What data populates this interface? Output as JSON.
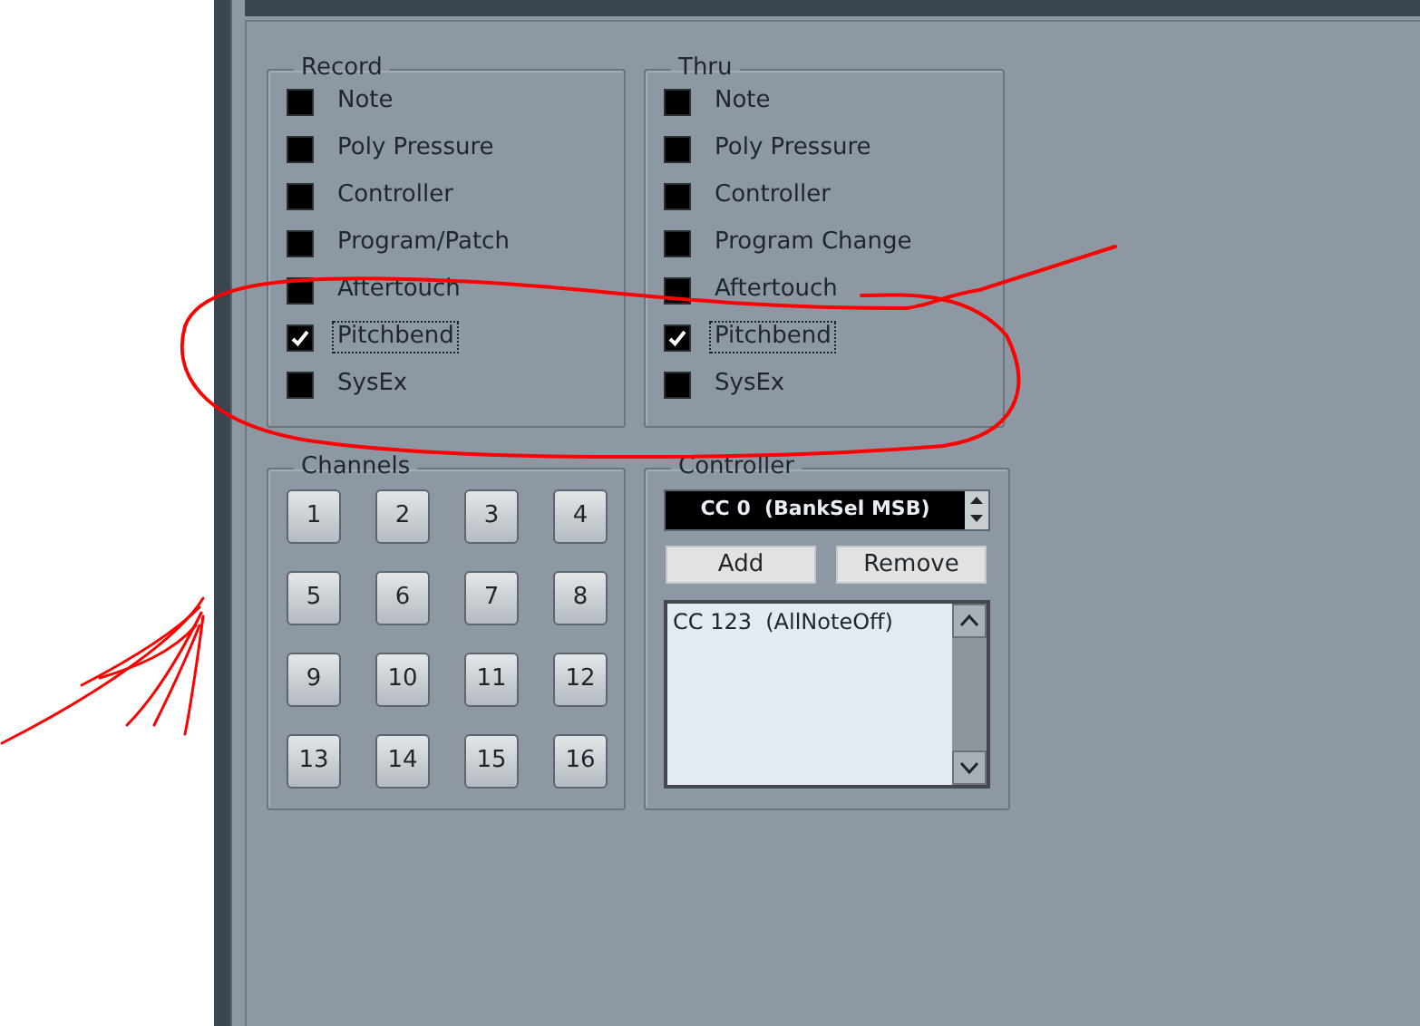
{
  "record": {
    "title": "Record",
    "items": [
      {
        "label": "Note",
        "checked": false,
        "focused": false
      },
      {
        "label": "Poly Pressure",
        "checked": false,
        "focused": false
      },
      {
        "label": "Controller",
        "checked": false,
        "focused": false
      },
      {
        "label": "Program/Patch",
        "checked": false,
        "focused": false
      },
      {
        "label": "Aftertouch",
        "checked": false,
        "focused": false
      },
      {
        "label": "Pitchbend",
        "checked": true,
        "focused": true
      },
      {
        "label": "SysEx",
        "checked": false,
        "focused": false
      }
    ]
  },
  "thru": {
    "title": "Thru",
    "items": [
      {
        "label": "Note",
        "checked": false,
        "focused": false
      },
      {
        "label": "Poly Pressure",
        "checked": false,
        "focused": false
      },
      {
        "label": "Controller",
        "checked": false,
        "focused": false
      },
      {
        "label": "Program Change",
        "checked": false,
        "focused": false
      },
      {
        "label": "Aftertouch",
        "checked": false,
        "focused": false
      },
      {
        "label": "Pitchbend",
        "checked": true,
        "focused": true
      },
      {
        "label": "SysEx",
        "checked": false,
        "focused": false
      }
    ]
  },
  "channels": {
    "title": "Channels",
    "buttons": [
      "1",
      "2",
      "3",
      "4",
      "5",
      "6",
      "7",
      "8",
      "9",
      "10",
      "11",
      "12",
      "13",
      "14",
      "15",
      "16"
    ]
  },
  "controller": {
    "title": "Controller",
    "selector": {
      "value": "CC 0  (BankSel MSB)"
    },
    "buttons": [
      "Add",
      "Remove"
    ],
    "list": {
      "items": [
        {
          "label": "CC 123  (AllNoteOff)"
        }
      ]
    }
  }
}
